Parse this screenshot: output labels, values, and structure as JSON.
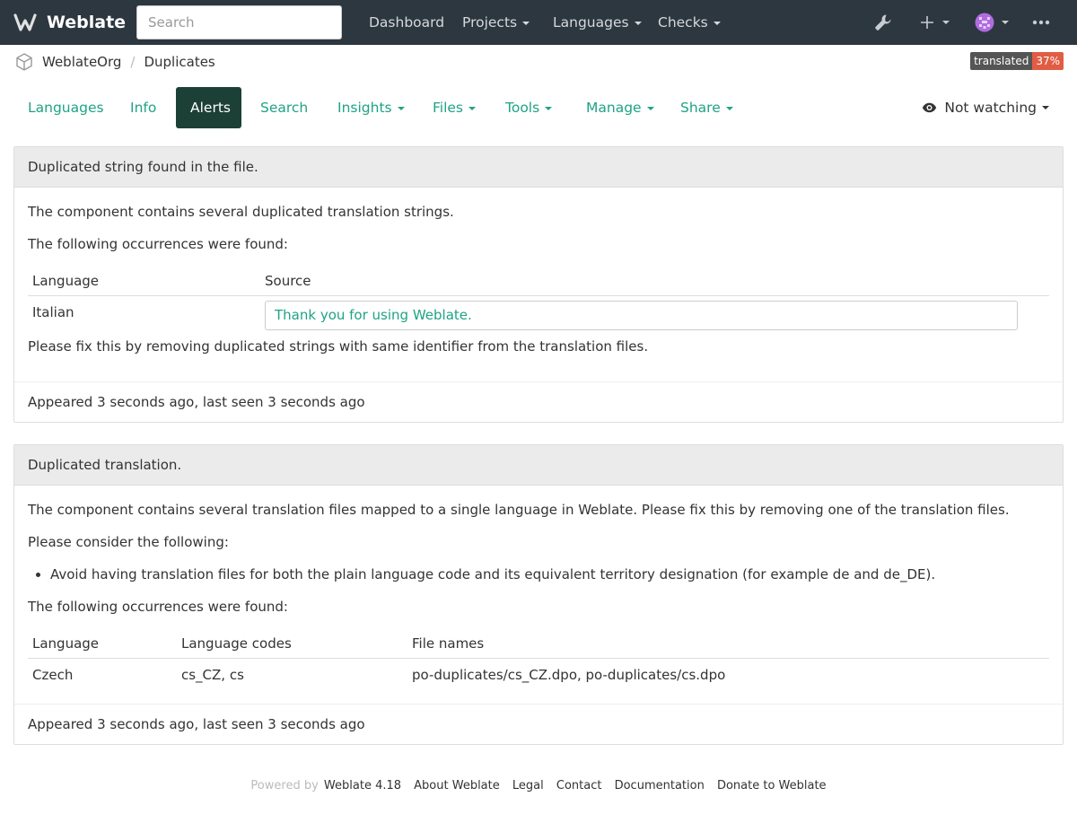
{
  "navbar": {
    "brand": "Weblate",
    "search_placeholder": "Search",
    "links": [
      "Dashboard",
      "Projects",
      "Languages",
      "Checks"
    ]
  },
  "breadcrumb": {
    "project": "WeblateOrg",
    "component": "Duplicates"
  },
  "badge": {
    "label": "translated",
    "value": "37%"
  },
  "tabs": {
    "languages": "Languages",
    "info": "Info",
    "alerts": "Alerts",
    "search": "Search",
    "insights": "Insights",
    "files": "Files",
    "tools": "Tools",
    "manage": "Manage",
    "share": "Share"
  },
  "watch": "Not watching",
  "alert1": {
    "heading": "Duplicated string found in the file.",
    "intro": "The component contains several duplicated translation strings.",
    "occurrences": "The following occurrences were found:",
    "col_language": "Language",
    "col_source": "Source",
    "row_language": "Italian",
    "row_source": "Thank you for using Weblate.",
    "fix": "Please fix this by removing duplicated strings with same identifier from the translation files.",
    "footer": "Appeared 3 seconds ago, last seen 3 seconds ago"
  },
  "alert2": {
    "heading": "Duplicated translation.",
    "intro": "The component contains several translation files mapped to a single language in Weblate. Please fix this by removing one of the translation files.",
    "consider": "Please consider the following:",
    "bullet": "Avoid having translation files for both the plain language code and its equivalent territory designation (for example de and de_DE).",
    "occurrences": "The following occurrences were found:",
    "col_language": "Language",
    "col_codes": "Language codes",
    "col_files": "File names",
    "row_language": "Czech",
    "row_codes": "cs_CZ, cs",
    "row_files": "po-duplicates/cs_CZ.dpo, po-duplicates/cs.dpo",
    "footer": "Appeared 3 seconds ago, last seen 3 seconds ago"
  },
  "footer": {
    "powered": "Powered by",
    "version": "Weblate 4.18",
    "about": "About Weblate",
    "legal": "Legal",
    "contact": "Contact",
    "documentation": "Documentation",
    "donate": "Donate to Weblate"
  }
}
